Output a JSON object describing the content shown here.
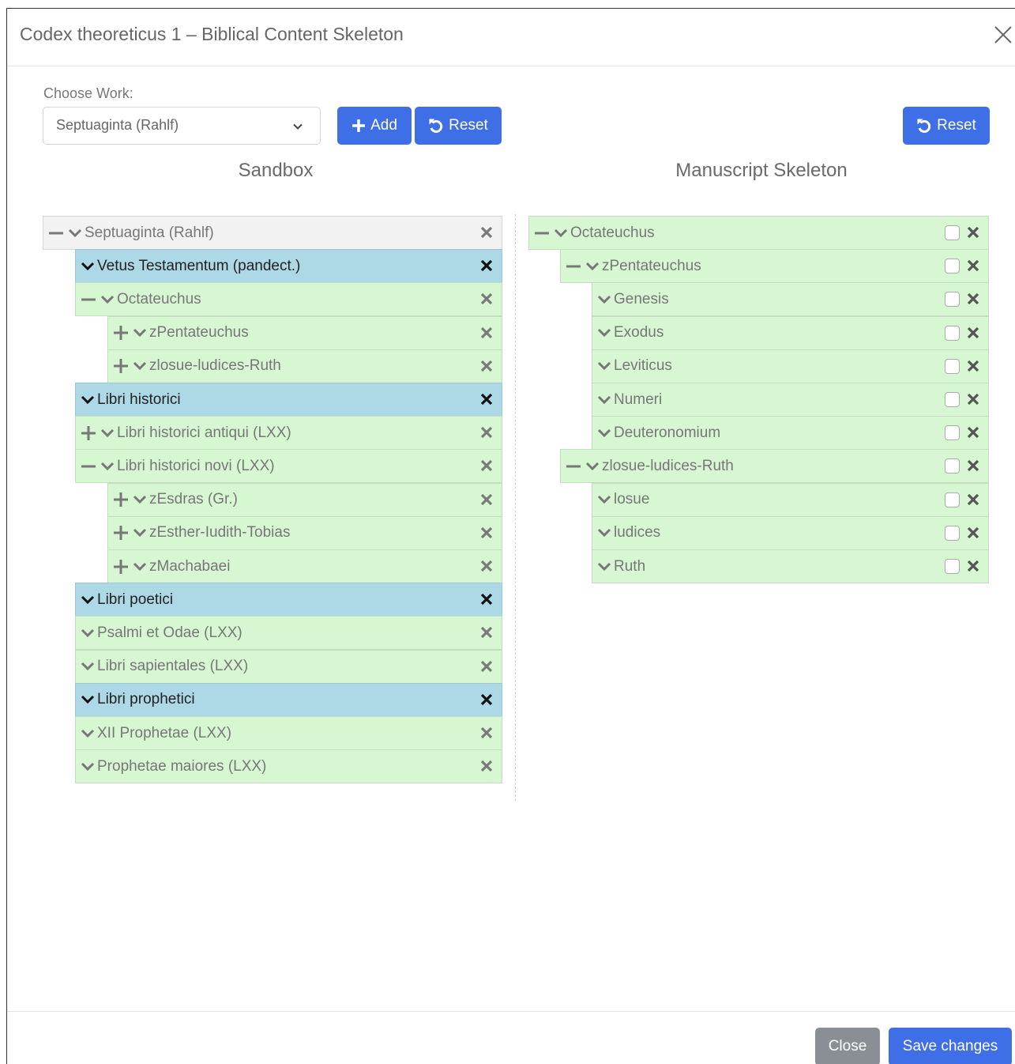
{
  "modal": {
    "title": "Codex theoreticus 1 – Biblical Content Skeleton",
    "choose_label": "Choose Work:",
    "selected_work": "Septuaginta (Rahlf)",
    "add_label": "Add",
    "reset_label": "Reset",
    "reset_right_label": "Reset",
    "sandbox_title": "Sandbox",
    "skeleton_title": "Manuscript Skeleton",
    "close_label": "Close",
    "save_label": "Save changes"
  },
  "colors": {
    "primary": "#3f6fe6",
    "secondary": "#8a8f96",
    "node_green": "#d6f7d2",
    "node_blue": "#add8e6",
    "node_root": "#f2f2f2"
  },
  "sandbox": [
    {
      "label": "Septuaginta (Rahlf)",
      "level": 0,
      "toggle": "minus",
      "style": "gray"
    },
    {
      "label": "Vetus Testamentum (pandect.)",
      "level": 1,
      "toggle": "none",
      "style": "blue"
    },
    {
      "label": "Octateuchus",
      "level": 1,
      "toggle": "minus",
      "style": "green"
    },
    {
      "label": "zPentateuchus",
      "level": 2,
      "toggle": "plus",
      "style": "green"
    },
    {
      "label": "zlosue-ludices-Ruth",
      "level": 2,
      "toggle": "plus",
      "style": "green"
    },
    {
      "label": "Libri historici",
      "level": 1,
      "toggle": "none",
      "style": "blue"
    },
    {
      "label": "Libri historici antiqui (LXX)",
      "level": 1,
      "toggle": "plus",
      "style": "green"
    },
    {
      "label": "Libri historici novi (LXX)",
      "level": 1,
      "toggle": "minus",
      "style": "green"
    },
    {
      "label": "zEsdras (Gr.)",
      "level": 2,
      "toggle": "plus",
      "style": "green"
    },
    {
      "label": "zEsther-Iudith-Tobias",
      "level": 2,
      "toggle": "plus",
      "style": "green"
    },
    {
      "label": "zMachabaei",
      "level": 2,
      "toggle": "plus",
      "style": "green"
    },
    {
      "label": "Libri poetici",
      "level": 1,
      "toggle": "none",
      "style": "blue"
    },
    {
      "label": "Psalmi et Odae (LXX)",
      "level": 1,
      "toggle": "none",
      "style": "green"
    },
    {
      "label": "Libri sapientales (LXX)",
      "level": 1,
      "toggle": "none",
      "style": "green"
    },
    {
      "label": "Libri prophetici",
      "level": 1,
      "toggle": "none",
      "style": "blue"
    },
    {
      "label": "XII Prophetae (LXX)",
      "level": 1,
      "toggle": "none",
      "style": "green"
    },
    {
      "label": "Prophetae maiores (LXX)",
      "level": 1,
      "toggle": "none",
      "style": "green"
    }
  ],
  "skeleton": [
    {
      "label": "Octateuchus",
      "level": 0,
      "toggle": "minus",
      "checked": false
    },
    {
      "label": "zPentateuchus",
      "level": 1,
      "toggle": "minus",
      "checked": false
    },
    {
      "label": "Genesis",
      "level": 2,
      "toggle": "none",
      "checked": false
    },
    {
      "label": "Exodus",
      "level": 2,
      "toggle": "none",
      "checked": false
    },
    {
      "label": "Leviticus",
      "level": 2,
      "toggle": "none",
      "checked": false
    },
    {
      "label": "Numeri",
      "level": 2,
      "toggle": "none",
      "checked": false
    },
    {
      "label": "Deuteronomium",
      "level": 2,
      "toggle": "none",
      "checked": false
    },
    {
      "label": "zlosue-ludices-Ruth",
      "level": 1,
      "toggle": "minus",
      "checked": false
    },
    {
      "label": "losue",
      "level": 2,
      "toggle": "none",
      "checked": false
    },
    {
      "label": "ludices",
      "level": 2,
      "toggle": "none",
      "checked": false
    },
    {
      "label": "Ruth",
      "level": 2,
      "toggle": "none",
      "checked": false
    }
  ]
}
